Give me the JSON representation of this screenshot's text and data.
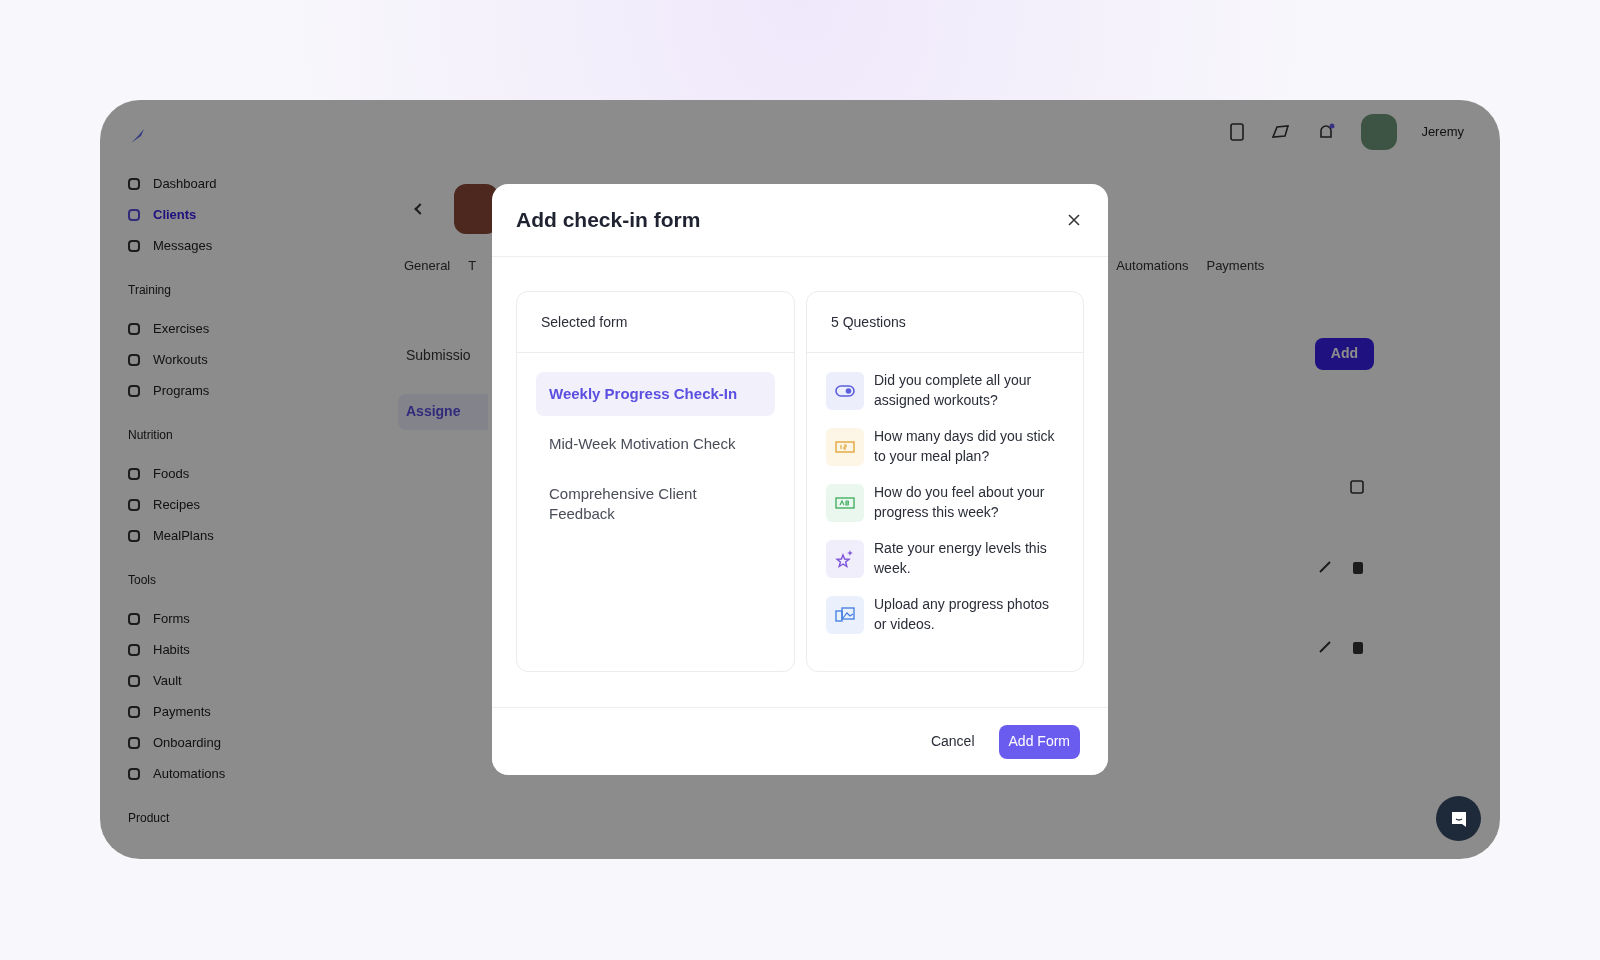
{
  "app": {
    "sidebar": {
      "sections": [
        {
          "items": [
            {
              "label": "Dashboard",
              "selected": false
            },
            {
              "label": "Clients",
              "selected": true
            },
            {
              "label": "Messages",
              "selected": false
            }
          ]
        },
        {
          "heading": "Training",
          "items": [
            {
              "label": "Exercises",
              "selected": false
            },
            {
              "label": "Workouts",
              "selected": false
            },
            {
              "label": "Programs",
              "selected": false
            }
          ]
        },
        {
          "heading": "Nutrition",
          "items": [
            {
              "label": "Foods",
              "selected": false
            },
            {
              "label": "Recipes",
              "selected": false
            },
            {
              "label": "MealPlans",
              "selected": false
            }
          ]
        },
        {
          "heading": "Tools",
          "items": [
            {
              "label": "Forms",
              "selected": false
            },
            {
              "label": "Habits",
              "selected": false
            },
            {
              "label": "Vault",
              "selected": false
            },
            {
              "label": "Payments",
              "selected": false
            },
            {
              "label": "Onboarding",
              "selected": false
            },
            {
              "label": "Automations",
              "selected": false
            }
          ]
        },
        {
          "heading": "Product"
        }
      ]
    },
    "topbar": {
      "user_name": "Jeremy"
    },
    "tabs_left": [
      {
        "label": "General",
        "selected": false
      },
      {
        "label": "T",
        "selected": false
      }
    ],
    "tabs_right": [
      {
        "label": "Automations",
        "selected": false
      },
      {
        "label": "Payments",
        "selected": false
      }
    ],
    "subtabs": [
      {
        "label": "Submissio",
        "selected": false
      },
      {
        "label": "Assigne",
        "selected": true
      }
    ],
    "add_button": "Add"
  },
  "modal": {
    "title": "Add check-in form",
    "forms_header": "Selected form",
    "forms": [
      {
        "label": "Weekly Progress Check-In",
        "selected": true
      },
      {
        "label": "Mid-Week Motivation Check",
        "selected": false
      },
      {
        "label": "Comprehensive Client Feedback",
        "selected": false
      }
    ],
    "questions_header": "5 Questions",
    "questions": [
      {
        "kind": "yes_no",
        "text": "Did you complete all your assigned workouts?"
      },
      {
        "kind": "number",
        "text": "How many days did you stick to your meal plan?"
      },
      {
        "kind": "text",
        "text": "How do you feel about your progress this week?"
      },
      {
        "kind": "rating",
        "text": "Rate your energy levels this week."
      },
      {
        "kind": "upload",
        "text": "Upload any progress photos or videos."
      }
    ],
    "cancel": "Cancel",
    "submit": "Add Form"
  }
}
